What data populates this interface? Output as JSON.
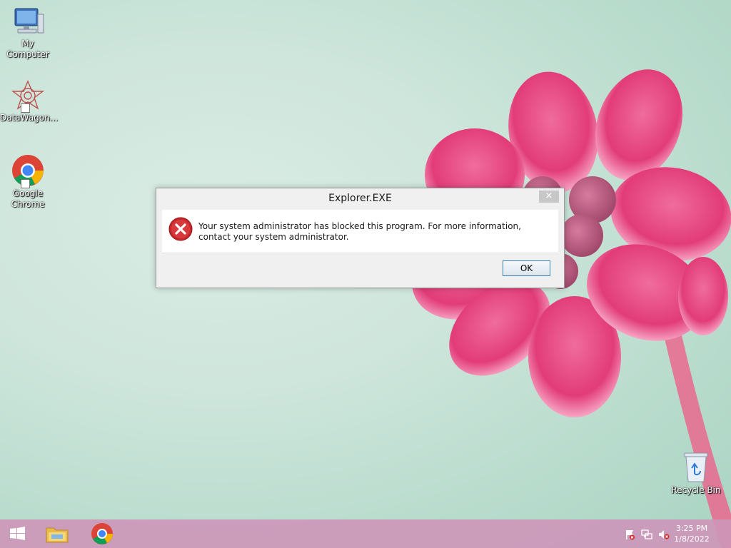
{
  "desktop": {
    "icons": [
      {
        "label": "My Computer",
        "icon": "computer-icon"
      },
      {
        "label": "DataWagon...",
        "icon": "datawagon-icon"
      },
      {
        "label": "Google Chrome",
        "icon": "chrome-icon"
      },
      {
        "label": "Recycle Bin",
        "icon": "recycle-bin-icon"
      }
    ]
  },
  "dialog": {
    "title": "Explorer.EXE",
    "close_label": "×",
    "message": "Your system administrator has blocked this program. For more information, contact your system administrator.",
    "ok_label": "OK",
    "icon": "error-icon"
  },
  "taskbar": {
    "buttons": [
      {
        "icon": "windows-start-icon"
      },
      {
        "icon": "file-explorer-icon"
      },
      {
        "icon": "chrome-icon"
      }
    ],
    "tray": [
      {
        "icon": "action-center-flag-icon"
      },
      {
        "icon": "network-icon"
      },
      {
        "icon": "volume-muted-icon"
      }
    ],
    "time": "3:25 PM",
    "date": "1/8/2022"
  },
  "colors": {
    "taskbar": "#cd96b9",
    "wallpaper_bg": "#cfe6dc",
    "flower": "#e8457e",
    "error_red": "#c8282c"
  }
}
